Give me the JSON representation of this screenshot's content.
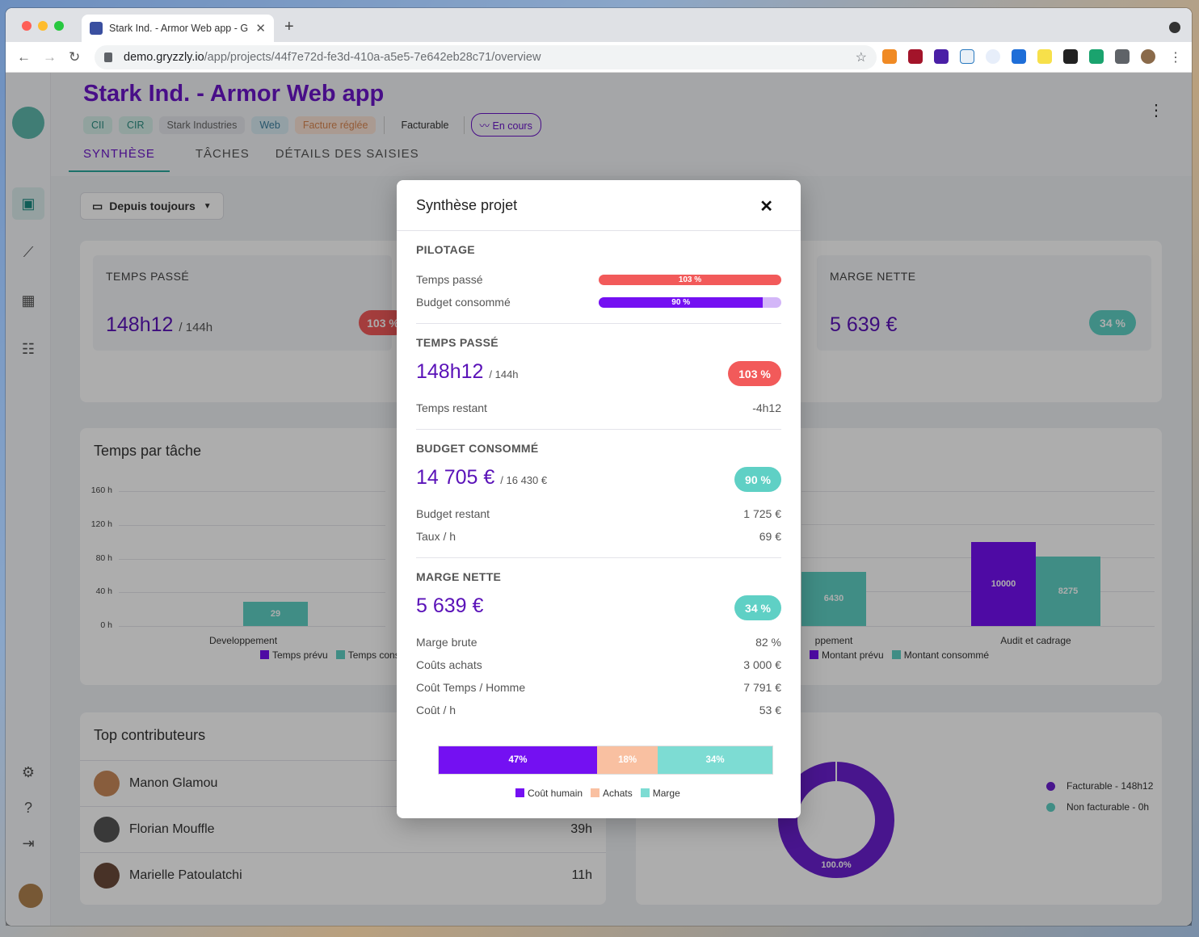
{
  "browser": {
    "tab_title": "Stark Ind. - Armor Web app - G",
    "url_host": "demo.gryzzly.io",
    "url_path": "/app/projects/44f7e72d-fe3d-410a-a5e5-7e642eb28c71/overview"
  },
  "project": {
    "title": "Stark Ind. - Armor Web app",
    "tags": [
      "CII",
      "CIR",
      "Stark Industries",
      "Web",
      "Facture réglée"
    ],
    "billing": "Facturable",
    "status": "En cours"
  },
  "tabs": [
    "SYNTHÈSE",
    "TÂCHES",
    "DÉTAILS DES SAISIES"
  ],
  "filter": {
    "label": "Depuis toujours"
  },
  "kpis": {
    "temps_label": "TEMPS PASSÉ",
    "temps_value": "148h12",
    "temps_total": "/ 144h",
    "temps_pct": "103 %",
    "marge_label": "MARGE NETTE",
    "marge_value": "5 639 €",
    "marge_pct": "34 %"
  },
  "tasks_card": {
    "title": "Temps par tâche",
    "legend": [
      "Temps prévu",
      "Temps cons"
    ]
  },
  "chart_data": [
    {
      "type": "bar",
      "title": "Temps par tâche",
      "y_ticks": [
        "160 h",
        "120 h",
        "80 h",
        "40 h",
        "0 h"
      ],
      "ylim": [
        0,
        160
      ],
      "categories": [
        "Developpement"
      ],
      "series": [
        {
          "name": "Temps prévu",
          "values": [
            null
          ]
        },
        {
          "name": "Temps cons",
          "values": [
            29
          ]
        }
      ],
      "value_labels": [
        "29"
      ]
    },
    {
      "type": "bar",
      "categories": [
        "…ppement",
        "Audit et cadrage"
      ],
      "series": [
        {
          "name": "Montant prévu",
          "values": [
            null,
            10000
          ]
        },
        {
          "name": "Montant consommé",
          "values": [
            6430,
            8275
          ]
        }
      ],
      "value_labels": [
        "6430",
        "10000",
        "8275"
      ],
      "ylim": [
        0,
        16000
      ]
    },
    {
      "type": "pie",
      "labels": [
        "Facturable - 148h12",
        "Non facturable - 0h"
      ],
      "values": [
        100,
        0
      ],
      "center_label": "100.0%"
    }
  ],
  "contributors": {
    "title": "Top contributeurs",
    "items": [
      {
        "name": "Manon Glamou",
        "hours": ""
      },
      {
        "name": "Florian Mouffle",
        "hours": "39h"
      },
      {
        "name": "Marielle Patoulatchi",
        "hours": "11h"
      }
    ]
  },
  "money_legend": [
    "Montant prévu",
    "Montant consommé"
  ],
  "money_x": [
    "ppement",
    "Audit et cadrage"
  ],
  "donut": {
    "center": "100.0%",
    "legend": [
      "Facturable - 148h12",
      "Non facturable - 0h"
    ]
  },
  "modal": {
    "title": "Synthèse projet",
    "pilotage": {
      "heading": "PILOTAGE",
      "temps_label": "Temps passé",
      "temps_pct": "103 %",
      "temps_fill": 1.0,
      "budget_label": "Budget consommé",
      "budget_pct": "90 %",
      "budget_fill": 0.9
    },
    "temps": {
      "heading": "TEMPS PASSÉ",
      "value": "148h12",
      "total": "/ 144h",
      "pct": "103 %",
      "restant_label": "Temps restant",
      "restant_value": "-4h12"
    },
    "budget": {
      "heading": "BUDGET CONSOMMÉ",
      "value": "14 705 €",
      "total": "/ 16 430 €",
      "pct": "90 %",
      "restant_label": "Budget restant",
      "restant_value": "1 725 €",
      "taux_label": "Taux / h",
      "taux_value": "69 €"
    },
    "marge": {
      "heading": "MARGE NETTE",
      "value": "5 639 €",
      "pct": "34 %",
      "rows": [
        {
          "label": "Marge brute",
          "value": "82 %"
        },
        {
          "label": "Coûts achats",
          "value": "3 000 €"
        },
        {
          "label": "Coût Temps / Homme",
          "value": "7 791 €"
        },
        {
          "label": "Coût / h",
          "value": "53 €"
        }
      ]
    },
    "breakdown": {
      "segments": [
        {
          "label": "Coût humain",
          "pct": "47%",
          "value": 47
        },
        {
          "label": "Achats",
          "pct": "18%",
          "value": 18
        },
        {
          "label": "Marge",
          "pct": "34%",
          "value": 34
        }
      ]
    }
  },
  "colors": {
    "purple": "#6b16c9",
    "teal": "#5fd0c5",
    "red": "#f25a5a",
    "peach": "#f9c0a1",
    "violet_bar": "#7410f2"
  }
}
